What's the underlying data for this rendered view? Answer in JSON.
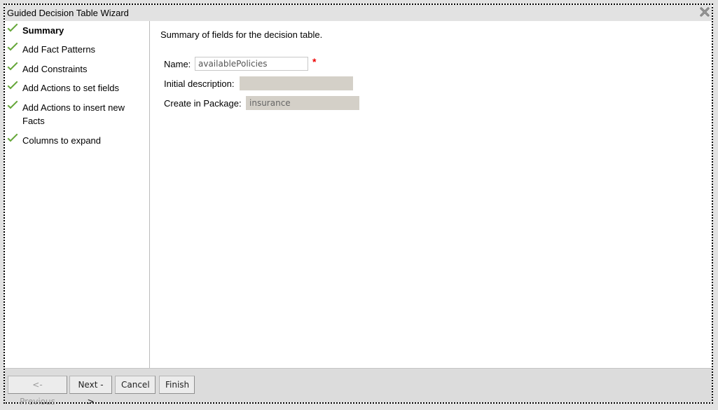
{
  "window": {
    "title": "Guided Decision Table Wizard",
    "close_icon": "close-x-icon"
  },
  "sidebar": {
    "items": [
      {
        "label": "Summary",
        "icon": "checkmark-icon",
        "active": true
      },
      {
        "label": "Add Fact Patterns",
        "icon": "checkmark-icon"
      },
      {
        "label": "Add Constraints",
        "icon": "checkmark-icon"
      },
      {
        "label": "Add Actions to set fields",
        "icon": "checkmark-icon"
      },
      {
        "label": "Add Actions to insert new Facts",
        "icon": "checkmark-icon"
      },
      {
        "label": "Columns to expand",
        "icon": "checkmark-icon"
      }
    ]
  },
  "main": {
    "intro": "Summary of fields for the decision table.",
    "fields": {
      "name": {
        "label": "Name:",
        "value": "availablePolicies",
        "required_marker": "*"
      },
      "description": {
        "label": "Initial description:",
        "value": ""
      },
      "package": {
        "label": "Create in Package:",
        "value": "insurance"
      }
    }
  },
  "footer": {
    "previous": "<- Previous",
    "next": "Next ->",
    "cancel": "Cancel",
    "finish": "Finish"
  },
  "colors": {
    "checkmark": "#6db33f",
    "required": "#ee0000",
    "titlebar": "#e2e2e2",
    "footer": "#dcdcdc"
  }
}
